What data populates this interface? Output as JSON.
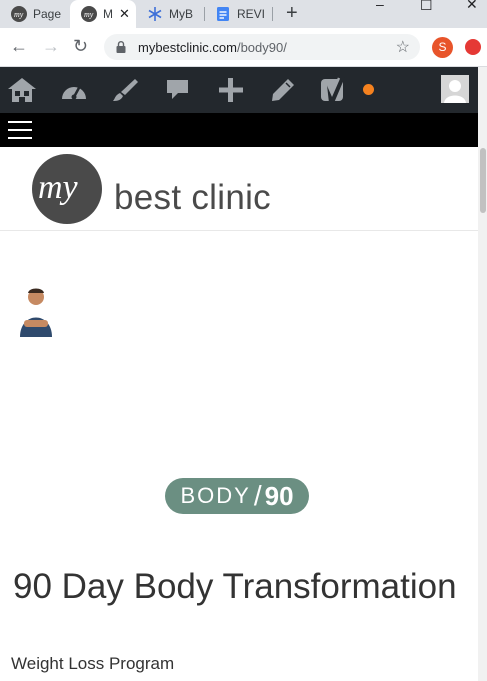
{
  "browser": {
    "tabs": [
      {
        "label": "Page"
      },
      {
        "label": "M"
      },
      {
        "label": "MyB"
      },
      {
        "label": "REVI"
      }
    ],
    "new_tab_symbol": "+",
    "url_host": "mybestclinic.com",
    "url_path": "/body90/",
    "extension_badge": "S"
  },
  "admin_bar": {
    "icons": [
      "my-sites-icon",
      "dashboard-icon",
      "customize-brush-icon",
      "comments-icon",
      "new-plus-icon",
      "edit-pencil-icon",
      "yoast-icon"
    ],
    "accent_color": "#f5821f"
  },
  "site": {
    "logo_mark": "my",
    "logo_text": "best clinic",
    "badge_left": "BODY",
    "badge_slash": "/",
    "badge_right": "90",
    "badge_color": "#6b8f82",
    "headline": "90 Day Body Transformation",
    "subheadline": "Weight Loss Program"
  }
}
